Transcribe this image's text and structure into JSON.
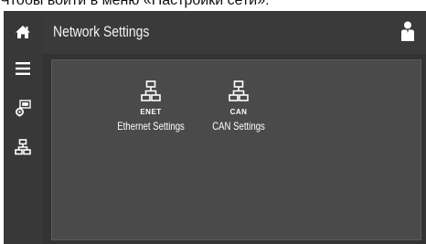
{
  "caption": "Чтобы войти в меню «Настройки сети»:",
  "header": {
    "title": "Network Settings"
  },
  "sidebar": {
    "items": [
      {
        "name": "home",
        "icon": "home-icon"
      },
      {
        "name": "menu",
        "icon": "menu-icon"
      },
      {
        "name": "device-settings",
        "icon": "device-settings-icon"
      },
      {
        "name": "network",
        "icon": "network-icon"
      }
    ]
  },
  "tiles": [
    {
      "sub_label": "ENET",
      "label": "Ethernet Settings",
      "icon": "network-icon"
    },
    {
      "sub_label": "CAN",
      "label": "CAN Settings",
      "icon": "network-icon"
    }
  ],
  "colors": {
    "background": "#333333",
    "panel": "#4a4a4a",
    "text": "#ffffff"
  }
}
